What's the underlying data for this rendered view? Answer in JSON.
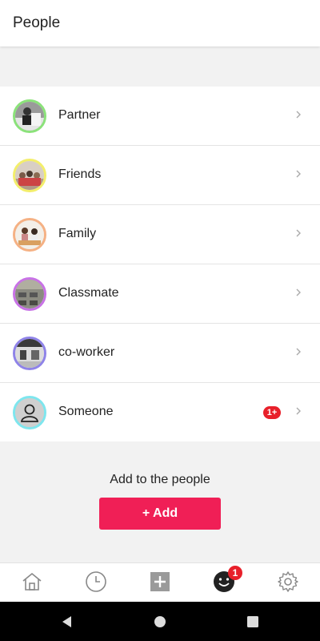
{
  "header": {
    "title": "People"
  },
  "people": [
    {
      "label": "Partner",
      "ring_color": "#8be27a",
      "icon": "partner-photo-icon"
    },
    {
      "label": "Friends",
      "ring_color": "#f3ee6b",
      "icon": "friends-photo-icon"
    },
    {
      "label": "Family",
      "ring_color": "#f5b184",
      "icon": "family-photo-icon"
    },
    {
      "label": "Classmate",
      "ring_color": "#c872e6",
      "icon": "classmate-photo-icon"
    },
    {
      "label": "co-worker",
      "ring_color": "#8f83e8",
      "icon": "coworker-photo-icon"
    },
    {
      "label": "Someone",
      "ring_color": "#7ee6ee",
      "icon": "person-placeholder-icon",
      "badge": "1+"
    }
  ],
  "add_section": {
    "text": "Add to the people",
    "button_label": "+ Add"
  },
  "tabbar": {
    "items": [
      "home-icon",
      "clock-icon",
      "add-square-icon",
      "smiley-icon",
      "gear-icon"
    ],
    "smiley_badge": "1"
  },
  "navbar": {
    "items": [
      "back-triangle-icon",
      "home-circle-icon",
      "recents-square-icon"
    ]
  },
  "colors": {
    "accent": "#f01f56",
    "badge": "#e8202a"
  }
}
